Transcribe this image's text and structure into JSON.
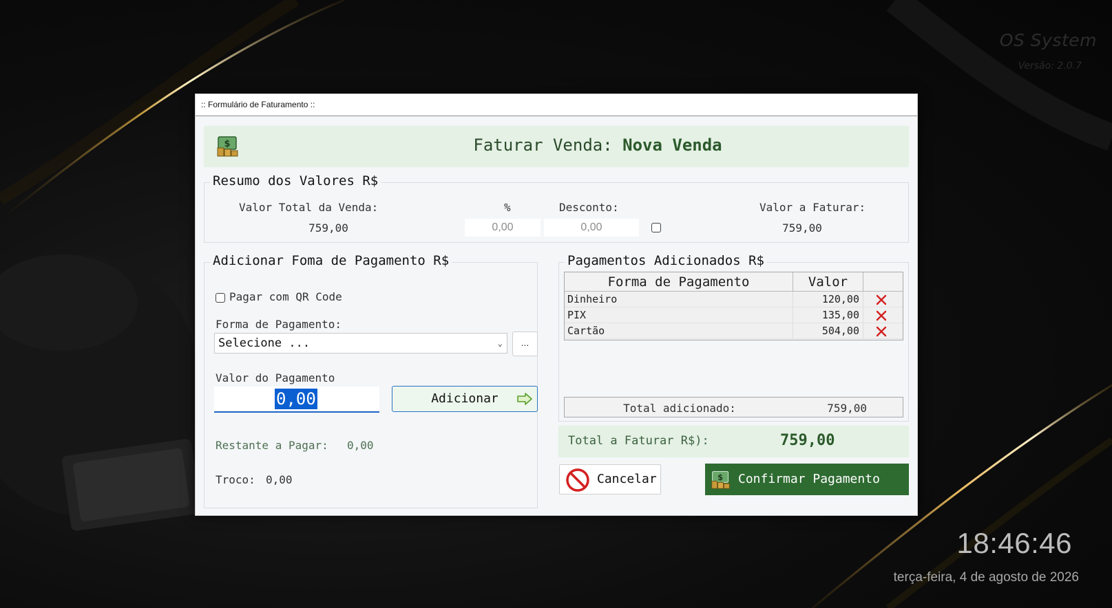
{
  "desktop": {
    "brand_name": "OS System",
    "brand_version": "Versão: 2.0.7",
    "clock_time": "18:46:46",
    "clock_date": "terça-feira, 4 de agosto de 2026"
  },
  "window": {
    "title": ":: Formulário de Faturamento ::"
  },
  "header": {
    "title_prefix": "Faturar Venda:",
    "title_value": "Nova Venda",
    "icon": "money-icon",
    "band_color": "#e4f1e4"
  },
  "summary": {
    "title": "Resumo dos Valores R$",
    "total_label": "Valor Total da Venda:",
    "total_value": "759,00",
    "percent_label": "%",
    "percent_value": "0,00",
    "discount_label": "Desconto:",
    "discount_value": "0,00",
    "to_bill_label": "Valor a Faturar:",
    "to_bill_value": "759,00"
  },
  "add_payment": {
    "title": "Adicionar Foma de Pagamento R$",
    "qr_label": "Pagar com QR Code",
    "method_label": "Forma de Pagamento:",
    "method_selected": "Selecione ...",
    "more_label": "...",
    "amount_label": "Valor do Pagamento",
    "amount_value": "0,00",
    "add_button": "Adicionar",
    "remaining_label": "Restante a Pagar:",
    "remaining_value": "0,00",
    "change_label": "Troco:",
    "change_value": "0,00"
  },
  "payments": {
    "title": "Pagamentos Adicionados R$",
    "columns": [
      "Forma de Pagamento",
      "Valor"
    ],
    "rows": [
      {
        "method": "Dinheiro",
        "value": "120,00"
      },
      {
        "method": "PIX",
        "value": "135,00"
      },
      {
        "method": "Cartão",
        "value": "504,00"
      }
    ],
    "total_added_label": "Total adicionado:",
    "total_added_value": "759,00"
  },
  "footer": {
    "total_label": "Total a Faturar R$):",
    "total_value": "759,00",
    "cancel_button": "Cancelar",
    "confirm_button": "Confirmar Pagamento",
    "confirm_color": "#2e6b31",
    "accent_color": "#0a5fd1",
    "delete_color": "#d42020"
  }
}
